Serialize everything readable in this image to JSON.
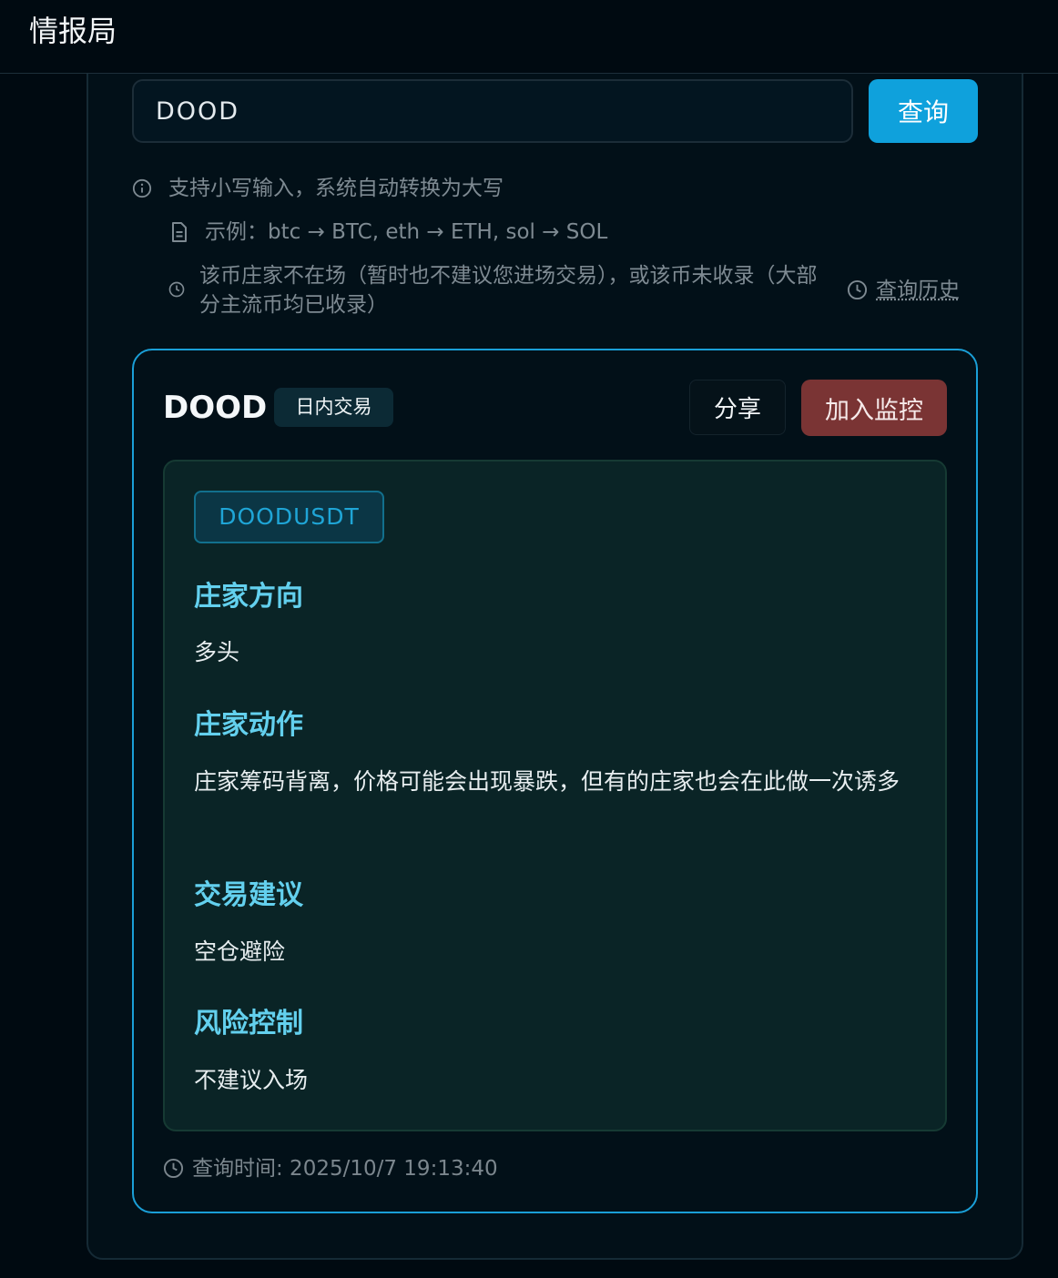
{
  "header": {
    "app_title": "情报局"
  },
  "search": {
    "value": "DOOD",
    "button_label": "查询"
  },
  "hints": {
    "tip": "支持小写输入，系统自动转换为大写",
    "example": "示例：btc → BTC, eth → ETH, sol → SOL",
    "notice": "该币庄家不在场（暂时也不建议您进场交易），或该币未收录（大部分主流币均已收录）",
    "history_link": "查询历史"
  },
  "result": {
    "coin": "DOOD",
    "tag": "日内交易",
    "share_label": "分享",
    "monitor_label": "加入监控",
    "pair": "DOODUSDT",
    "sections": [
      {
        "title": "庄家方向",
        "body": "多头"
      },
      {
        "title": "庄家动作",
        "body": "庄家筹码背离，价格可能会出现暴跌，但有的庄家也会在此做一次诱多"
      },
      {
        "title": "交易建议",
        "body": "空仓避险"
      },
      {
        "title": "风险控制",
        "body": "不建议入场"
      }
    ],
    "query_time": "查询时间: 2025/10/7 19:13:40"
  },
  "colors": {
    "accent": "#0fa1dc",
    "monitor": "#7a3434",
    "section_title": "#63d0ee"
  }
}
